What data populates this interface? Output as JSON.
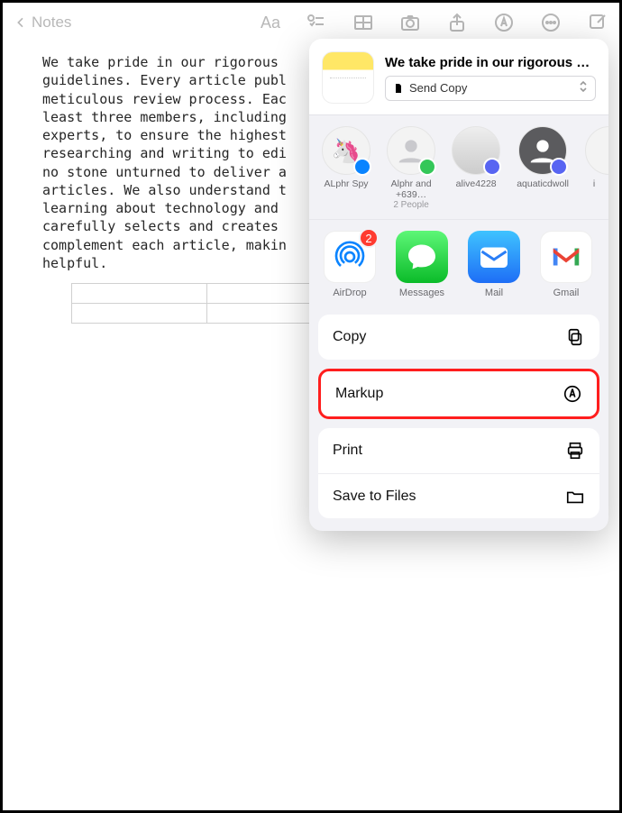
{
  "toolbar": {
    "back_label": "Notes"
  },
  "note": {
    "text": "We take pride in our rigorous\nguidelines. Every article publ\nmeticulous review process. Eac\nleast three members, including\nexperts, to ensure the highest\nresearching and writing to edi\nno stone unturned to deliver a\narticles. We also understand t\nlearning about technology and\ncarefully selects and creates\ncomplement each article, makin\nhelpful."
  },
  "sheet": {
    "title": "We take pride in our rigorous edit…",
    "send_copy_label": "Send Copy",
    "people": [
      {
        "name": "ALphr  Spy",
        "sub": "",
        "emoji": "🦄",
        "badge": "blue"
      },
      {
        "name": "Alphr and +639…",
        "sub": "2 People",
        "emoji": "",
        "badge": "green"
      },
      {
        "name": "alive4228",
        "sub": "",
        "emoji": "",
        "badge": "purple"
      },
      {
        "name": "aquaticdwoll",
        "sub": "",
        "emoji": "",
        "badge": "purple"
      },
      {
        "name": "i",
        "sub": "",
        "emoji": "",
        "badge": ""
      }
    ],
    "apps": [
      {
        "name": "AirDrop",
        "icon": "airdrop",
        "badge": "2"
      },
      {
        "name": "Messages",
        "icon": "messages",
        "badge": ""
      },
      {
        "name": "Mail",
        "icon": "mail",
        "badge": ""
      },
      {
        "name": "Gmail",
        "icon": "gmail",
        "badge": ""
      }
    ],
    "actions": {
      "copy": "Copy",
      "markup": "Markup",
      "print": "Print",
      "save": "Save to Files"
    }
  }
}
